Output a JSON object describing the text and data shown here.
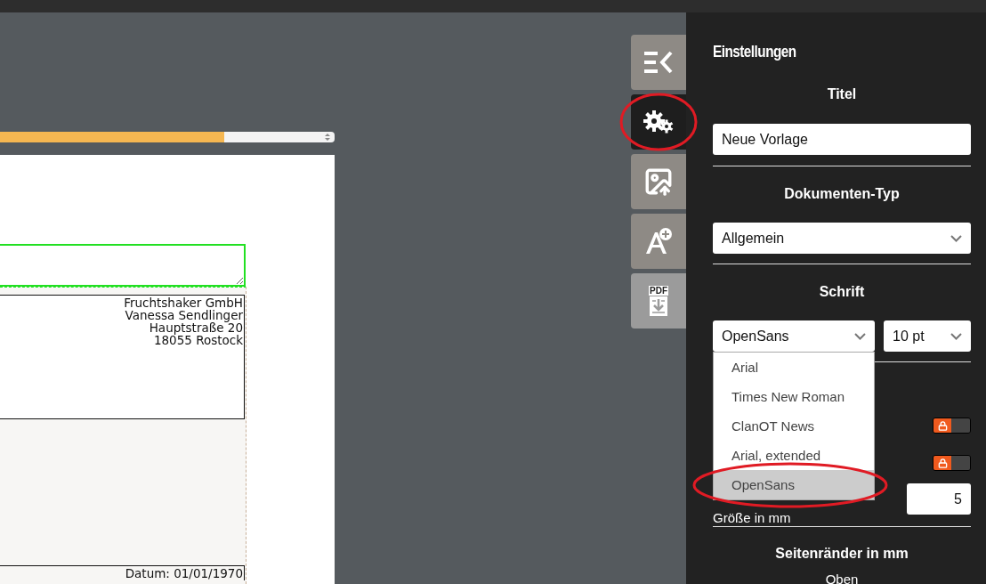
{
  "canvas": {
    "zoom_bar": {
      "level": 0.67
    },
    "address_lines": [
      "Fruchtshaker GmbH",
      "Vanessa Sendlinger",
      "Hauptstraße 20",
      "18055 Rostock"
    ],
    "date": "Datum: 01/01/1970"
  },
  "toolbar": [
    {
      "kind": "collapse",
      "selected": false,
      "highlighted": false
    },
    {
      "kind": "settings",
      "selected": true,
      "highlighted": true
    },
    {
      "kind": "image-upload",
      "selected": false,
      "highlighted": false
    },
    {
      "kind": "add-font",
      "selected": false,
      "highlighted": false
    },
    {
      "kind": "pdf",
      "label": "PDF",
      "selected": false,
      "highlighted": false
    }
  ],
  "panel": {
    "title": "Einstellungen",
    "title_heading": "Titel",
    "title_value": "Neue Vorlage",
    "doctype_heading": "Dokumenten-Typ",
    "doctype_value": "Allgemein",
    "font_heading": "Schrift",
    "font_value": "OpenSans",
    "size_value": "10 pt",
    "font_options": [
      {
        "label": "Arial",
        "selected": false,
        "highlighted": false
      },
      {
        "label": "Times New Roman",
        "selected": false,
        "highlighted": false
      },
      {
        "label": "ClanOT News",
        "selected": false,
        "highlighted": false
      },
      {
        "label": "Arial, extended",
        "selected": false,
        "highlighted": false
      },
      {
        "label": "OpenSans",
        "selected": true,
        "highlighted": true
      }
    ],
    "toggles": [
      {
        "on": true
      },
      {
        "on": true
      }
    ],
    "size_label": "Größe in mm",
    "size_mm": "5",
    "margins_heading": "Seitenränder in mm",
    "margins_top_label": "Oben"
  }
}
